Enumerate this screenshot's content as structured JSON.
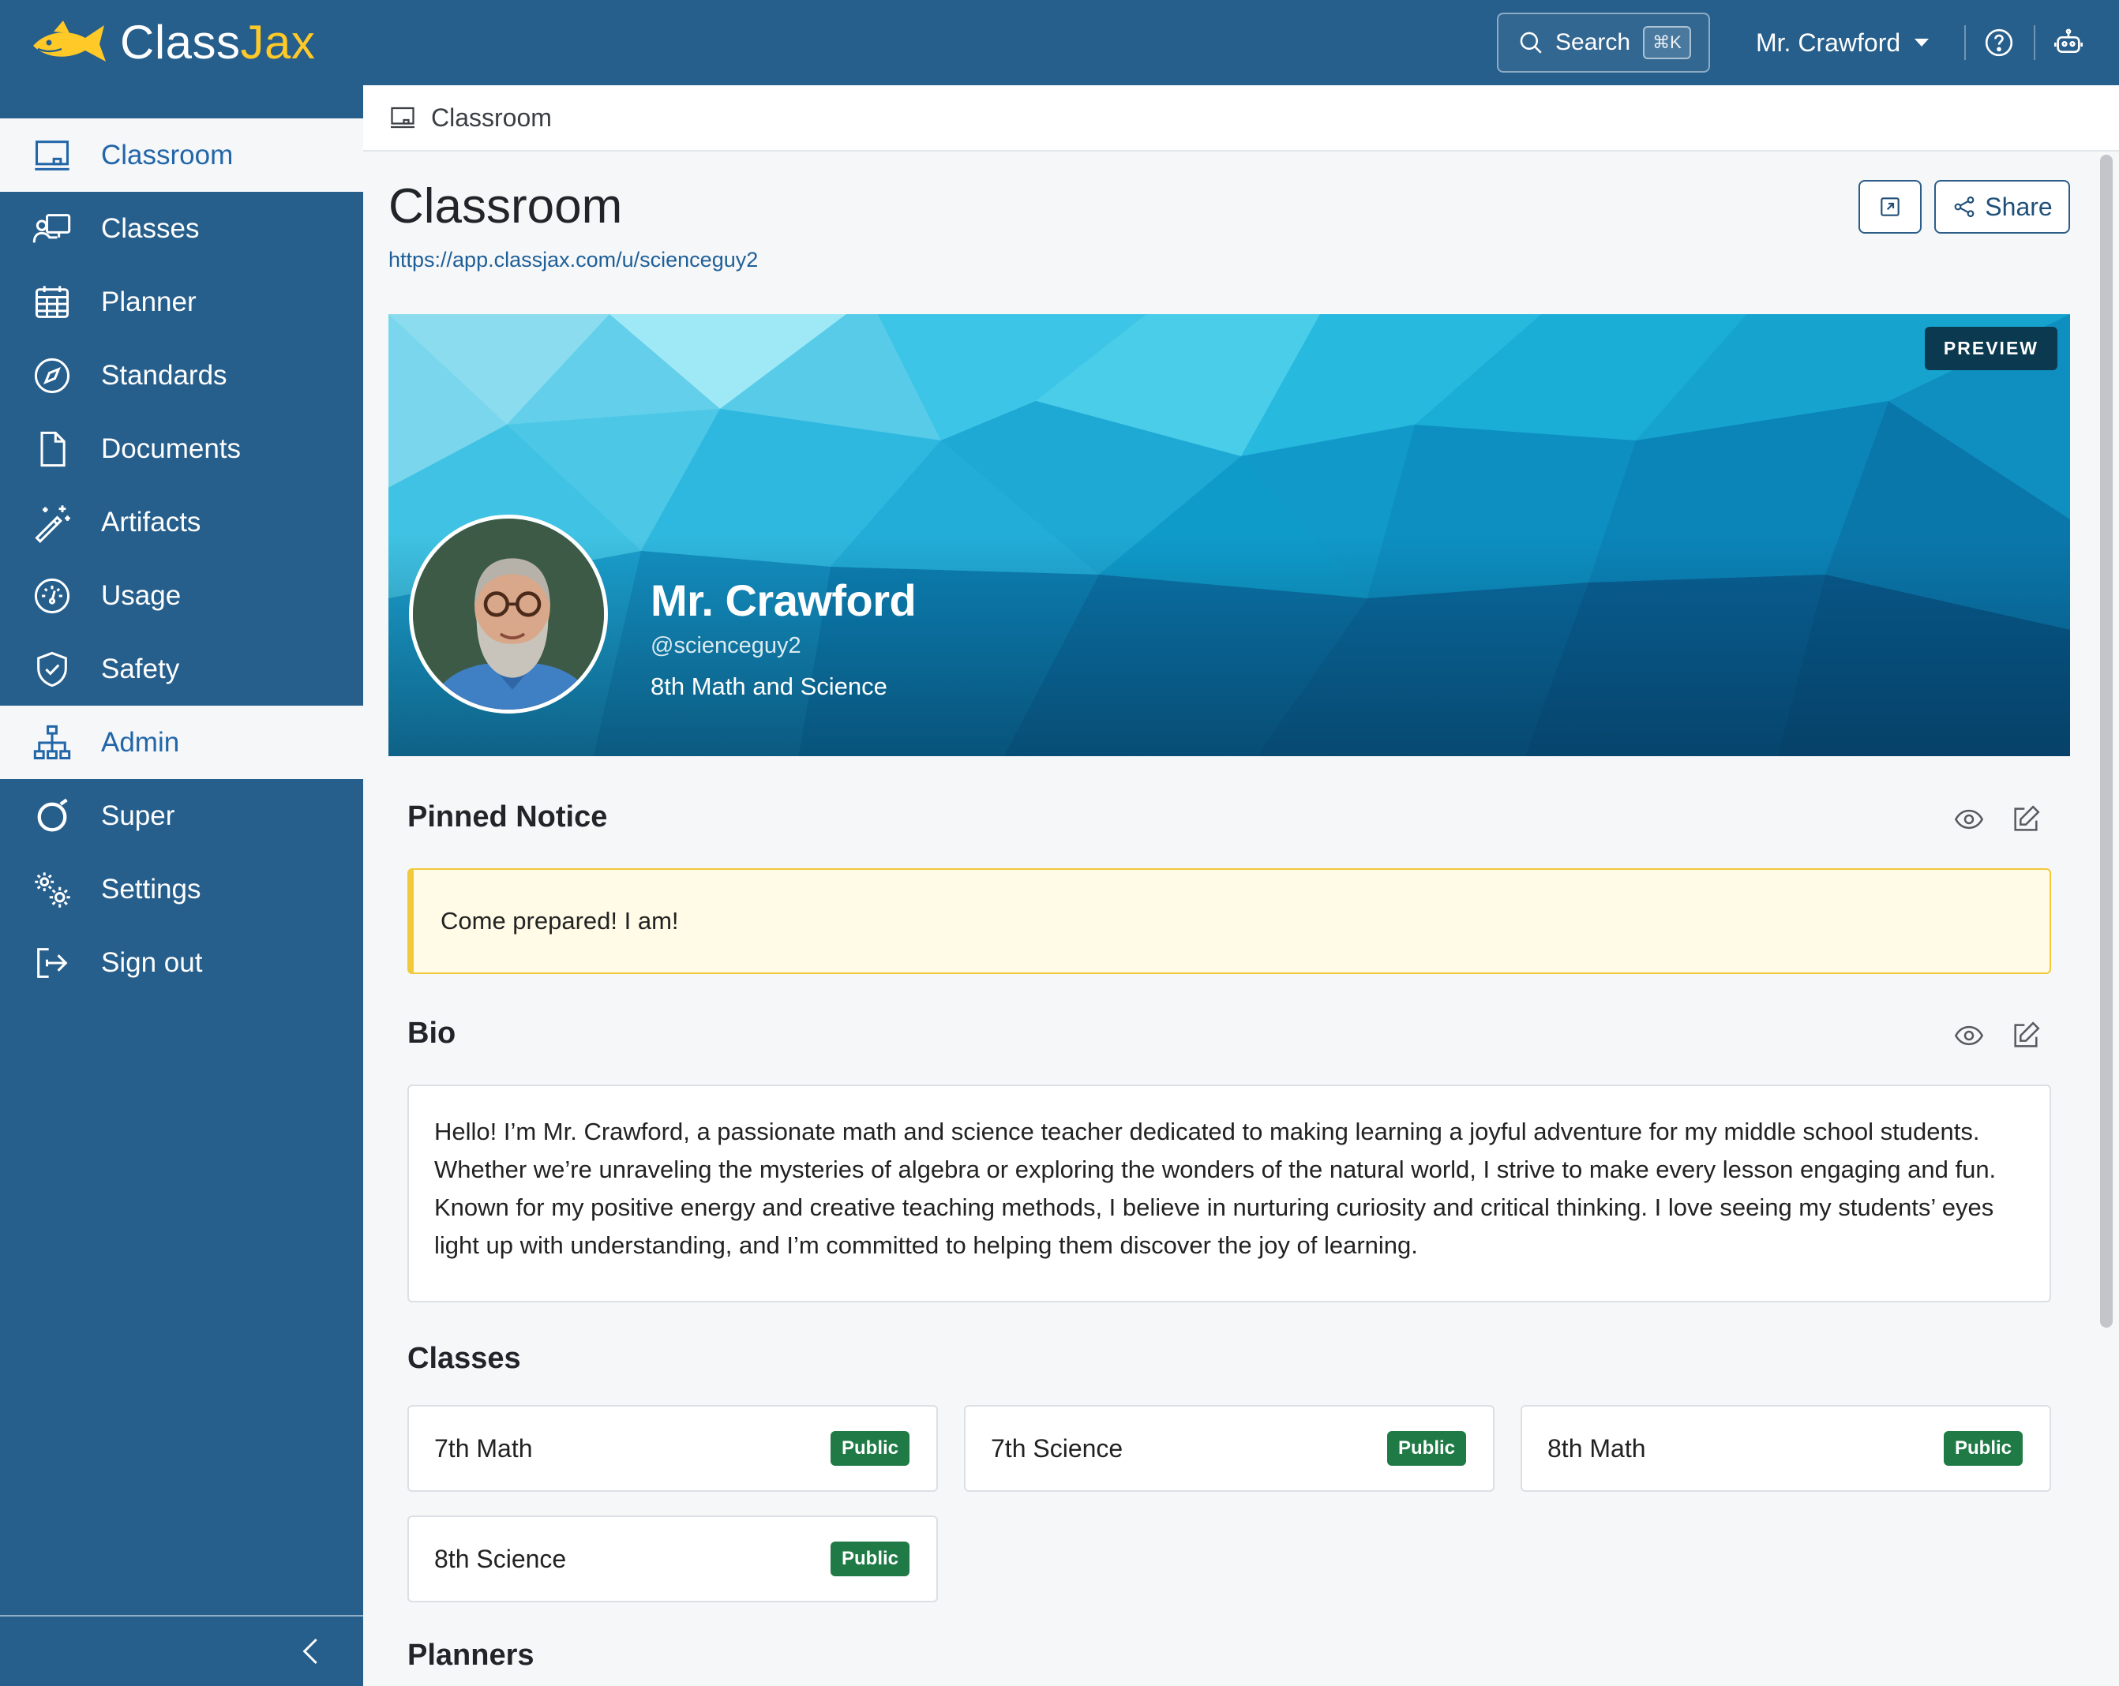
{
  "app": {
    "brand_left": "Class",
    "brand_right": "Jax",
    "accent_color": "#265e8c",
    "brand_yellow": "#ffc928"
  },
  "topbar": {
    "search_label": "Search",
    "search_shortcut": "⌘K",
    "user_name": "Mr. Crawford",
    "icons": [
      "search-icon",
      "help-icon",
      "robot-icon"
    ]
  },
  "sidebar": {
    "items": [
      {
        "label": "Classroom",
        "icon": "whiteboard-icon",
        "active": true
      },
      {
        "label": "Classes",
        "icon": "teacher-board-icon",
        "active": false
      },
      {
        "label": "Planner",
        "icon": "calendar-icon",
        "active": false
      },
      {
        "label": "Standards",
        "icon": "compass-icon",
        "active": false
      },
      {
        "label": "Documents",
        "icon": "document-icon",
        "active": false
      },
      {
        "label": "Artifacts",
        "icon": "magic-wand-icon",
        "active": false
      },
      {
        "label": "Usage",
        "icon": "gauge-icon",
        "active": false
      },
      {
        "label": "Safety",
        "icon": "shield-check-icon",
        "active": false
      },
      {
        "label": "Admin",
        "icon": "org-chart-icon",
        "active": true
      },
      {
        "label": "Super",
        "icon": "ring-icon",
        "active": false
      },
      {
        "label": "Settings",
        "icon": "gears-icon",
        "active": false
      },
      {
        "label": "Sign out",
        "icon": "sign-out-icon",
        "active": false
      }
    ],
    "collapse_icon": "chevron-left-icon"
  },
  "breadcrumb": {
    "label": "Classroom"
  },
  "main": {
    "title": "Classroom",
    "url": "https://app.classjax.com/u/scienceguy2",
    "share_label": "Share"
  },
  "profile": {
    "badge": "PREVIEW",
    "name": "Mr. Crawford",
    "handle": "@scienceguy2",
    "role": "8th Math and Science"
  },
  "pinned_notice": {
    "title": "Pinned Notice",
    "text": "Come prepared! I am!"
  },
  "bio": {
    "title": "Bio",
    "text": "Hello! I’m Mr. Crawford, a passionate math and science teacher dedicated to making learning a joyful adventure for my middle school students. Whether we’re unraveling the mysteries of algebra or exploring the wonders of the natural world, I strive to make every lesson engaging and fun. Known for my positive energy and creative teaching methods, I believe in nurturing curiosity and critical thinking. I love seeing my students’ eyes light up with understanding, and I’m committed to helping them discover the joy of learning."
  },
  "classes": {
    "title": "Classes",
    "items": [
      {
        "name": "7th Math",
        "visibility": "Public"
      },
      {
        "name": "7th Science",
        "visibility": "Public"
      },
      {
        "name": "8th Math",
        "visibility": "Public"
      },
      {
        "name": "8th Science",
        "visibility": "Public"
      }
    ]
  },
  "planners": {
    "title": "Planners"
  }
}
